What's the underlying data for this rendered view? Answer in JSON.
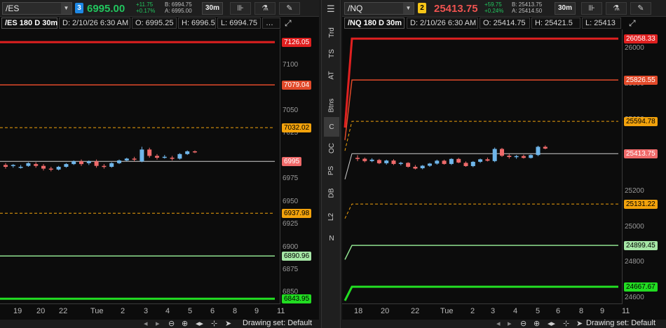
{
  "sidebar": {
    "menu_icon": "hamburger-menu-icon",
    "tabs": [
      {
        "label": "Trd"
      },
      {
        "label": "TS"
      },
      {
        "label": "AT"
      },
      {
        "label": "Btns"
      },
      {
        "label": "C"
      },
      {
        "label": "OC"
      },
      {
        "label": "PS"
      },
      {
        "label": "DB"
      },
      {
        "label": "L2"
      },
      {
        "label": "N"
      }
    ],
    "active_tab": "C"
  },
  "left": {
    "symbol": "/ES",
    "link_badge": "3",
    "link_color": "#1e88e5",
    "last": "6995.00",
    "change": "+11.75",
    "change_pct": "+0.17%",
    "bid": "B: 6994.75",
    "ask": "A: 6995.00",
    "timeframe": "30m",
    "info": {
      "title": "/ES 180 D 30m",
      "date": "D: 2/10/26 6:30 AM",
      "open": "O: 6995.25",
      "high": "H: 6996.5",
      "low": "L: 6994.75",
      "more": "…"
    },
    "yticks": [
      "7100",
      "7075",
      "7050",
      "7025",
      "6975",
      "6950",
      "6925",
      "6900",
      "6875",
      "6850"
    ],
    "levels": [
      {
        "label": "7126.05",
        "color": "#e02020",
        "bg": "#e02020",
        "fg": "#ffffff"
      },
      {
        "label": "7079.04",
        "color": "#e24a2a",
        "bg": "#e24a2a",
        "fg": "#ffffff"
      },
      {
        "label": "7032.02",
        "color": "#f2a20c",
        "bg": "#f2a20c",
        "fg": "#000000"
      },
      {
        "label": "6995",
        "color": "#d0d0d0",
        "bg": "#ef6a6a",
        "fg": "#ffffff"
      },
      {
        "label": "6937.98",
        "color": "#f2a20c",
        "bg": "#f2a20c",
        "fg": "#000000"
      },
      {
        "label": "6890.96",
        "color": "#8fe08f",
        "bg": "#a6e6a6",
        "fg": "#000000"
      },
      {
        "label": "6843.95",
        "color": "#22dd22",
        "bg": "#22dd22",
        "fg": "#000000"
      }
    ],
    "xticks": [
      "19",
      "20",
      "22",
      "Tue",
      "2",
      "3",
      "4",
      "5",
      "6",
      "8",
      "9",
      "11"
    ],
    "drawing_set": "Drawing set: Default"
  },
  "right": {
    "symbol": "/NQ",
    "link_badge": "2",
    "link_color": "#f5c518",
    "last": "25413.75",
    "change": "+59.75",
    "change_pct": "+0.24%",
    "bid": "B: 25413.75",
    "ask": "A: 25414.50",
    "timeframe": "30m",
    "info": {
      "title": "/NQ 180 D 30m",
      "date": "D: 2/10/26 6:30 AM",
      "open": "O: 25414.75",
      "high": "H: 25421.5",
      "low": "L: 25413",
      "more": "…"
    },
    "yticks": [
      "26000",
      "25800",
      "25600",
      "25400",
      "25200",
      "25000",
      "24800",
      "24600"
    ],
    "levels": [
      {
        "label": "26058.33",
        "color": "#e02020",
        "bg": "#e02020",
        "fg": "#ffffff"
      },
      {
        "label": "25826.55",
        "color": "#e24a2a",
        "bg": "#e24a2a",
        "fg": "#ffffff"
      },
      {
        "label": "25594.78",
        "color": "#f2a20c",
        "bg": "#f2a20c",
        "fg": "#000000"
      },
      {
        "label": "25413.75",
        "color": "#d0d0d0",
        "bg": "#ef6a6a",
        "fg": "#ffffff"
      },
      {
        "label": "25131.22",
        "color": "#f2a20c",
        "bg": "#f2a20c",
        "fg": "#000000"
      },
      {
        "label": "24899.45",
        "color": "#8fe08f",
        "bg": "#a6e6a6",
        "fg": "#000000"
      },
      {
        "label": "24667.67",
        "color": "#22dd22",
        "bg": "#22dd22",
        "fg": "#000000"
      }
    ],
    "xticks": [
      "18",
      "20",
      "22",
      "Tue",
      "2",
      "3",
      "4",
      "5",
      "6",
      "8",
      "9",
      "11"
    ],
    "drawing_set": "Drawing set: Default"
  },
  "colors": {
    "up_candle": "#6fb6ea",
    "down_candle": "#ef6a6a",
    "last_price": "#ef5350",
    "positive": "#22c55e"
  },
  "icons": {
    "style": "candlestick-style-icon",
    "studies": "flask-studies-icon",
    "drawings": "drawing-pencil-icon",
    "expand": "expand-arrow-icon",
    "zoom_out": "zoom-out-icon",
    "zoom_in": "zoom-in-icon",
    "pan": "pan-arrows-icon",
    "crosshair": "crosshair-icon",
    "cursor": "cursor-arrow-icon"
  },
  "chart_data": [
    {
      "type": "candlestick",
      "symbol": "/ES",
      "ylim": [
        6838,
        7140
      ],
      "candles": [
        [
          6991,
          6993,
          6987,
          6989
        ],
        [
          6990,
          6992,
          6988,
          6991
        ],
        [
          6989,
          6991,
          6987,
          6989
        ],
        [
          6990,
          6994,
          6989,
          6993
        ],
        [
          6992,
          6994,
          6988,
          6990
        ],
        [
          6990,
          6992,
          6985,
          6987
        ],
        [
          6987,
          6989,
          6984,
          6986
        ],
        [
          6986,
          6990,
          6985,
          6989
        ],
        [
          6989,
          6993,
          6988,
          6992
        ],
        [
          6992,
          6996,
          6991,
          6995
        ],
        [
          6995,
          6997,
          6990,
          6992
        ],
        [
          6993,
          6996,
          6991,
          6995
        ],
        [
          6995,
          6997,
          6988,
          6990
        ],
        [
          6990,
          6992,
          6987,
          6989
        ],
        [
          6989,
          6994,
          6988,
          6993
        ],
        [
          6993,
          6997,
          6992,
          6996
        ],
        [
          6996,
          6999,
          6995,
          6998
        ],
        [
          6998,
          7000,
          6995,
          6997
        ],
        [
          6995,
          7011,
          6994,
          7008
        ],
        [
          7008,
          7010,
          6999,
          7001
        ],
        [
          7001,
          7003,
          6997,
          6999
        ],
        [
          6999,
          7002,
          6998,
          7000
        ],
        [
          6999,
          7001,
          6996,
          6998
        ],
        [
          6998,
          7004,
          6997,
          7003
        ],
        [
          7003,
          7007,
          7002,
          7006
        ],
        [
          7006,
          7007,
          7004,
          7005
        ]
      ]
    },
    {
      "type": "candlestick",
      "symbol": "/NQ",
      "ylim": [
        24570,
        26110
      ],
      "candles": [
        [
          25390,
          25405,
          25372,
          25385
        ],
        [
          25385,
          25392,
          25365,
          25372
        ],
        [
          25372,
          25388,
          25366,
          25380
        ],
        [
          25378,
          25384,
          25355,
          25360
        ],
        [
          25360,
          25380,
          25352,
          25375
        ],
        [
          25375,
          25382,
          25350,
          25356
        ],
        [
          25356,
          25368,
          25348,
          25362
        ],
        [
          25362,
          25366,
          25335,
          25340
        ],
        [
          25340,
          25350,
          25325,
          25330
        ],
        [
          25332,
          25350,
          25326,
          25346
        ],
        [
          25346,
          25362,
          25340,
          25358
        ],
        [
          25358,
          25380,
          25352,
          25374
        ],
        [
          25374,
          25380,
          25352,
          25356
        ],
        [
          25356,
          25388,
          25350,
          25384
        ],
        [
          25384,
          25390,
          25360,
          25364
        ],
        [
          25362,
          25370,
          25340,
          25344
        ],
        [
          25344,
          25372,
          25338,
          25368
        ],
        [
          25368,
          25386,
          25362,
          25382
        ],
        [
          25382,
          25392,
          25370,
          25374
        ],
        [
          25372,
          25448,
          25366,
          25440
        ],
        [
          25440,
          25446,
          25396,
          25402
        ],
        [
          25402,
          25412,
          25386,
          25395
        ],
        [
          25395,
          25406,
          25385,
          25400
        ],
        [
          25400,
          25408,
          25386,
          25390
        ],
        [
          25390,
          25410,
          25386,
          25406
        ],
        [
          25406,
          25458,
          25400,
          25452
        ],
        [
          25452,
          25460,
          25438,
          25442
        ]
      ]
    }
  ]
}
